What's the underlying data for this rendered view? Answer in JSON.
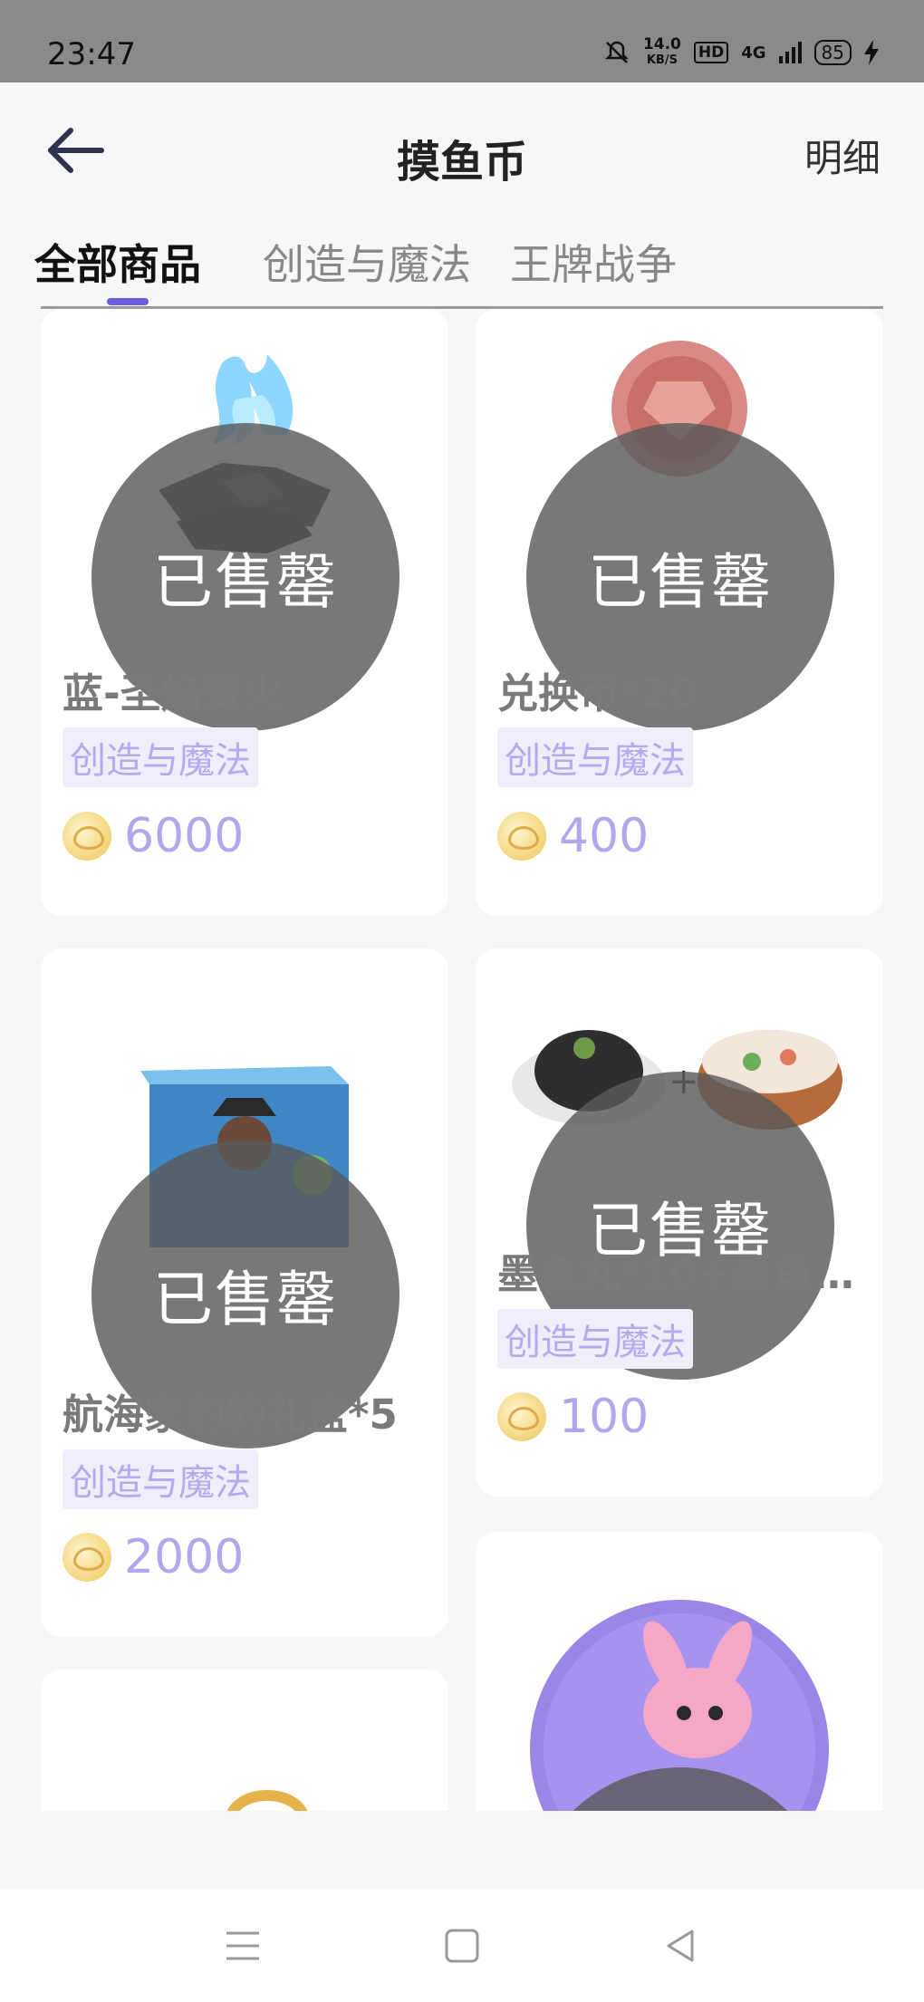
{
  "status_bar": {
    "time": "23:47",
    "speed_value": "14.0",
    "speed_unit": "KB/S",
    "hd": "HD",
    "network": "4G",
    "battery": "85"
  },
  "header": {
    "title": "摸鱼币",
    "detail_label": "明细"
  },
  "tabs": [
    {
      "label": "全部商品",
      "active": true
    },
    {
      "label": "创造与魔法",
      "active": false
    },
    {
      "label": "王牌战争",
      "active": false
    }
  ],
  "sold_out_label": "已售罄",
  "products": [
    {
      "name": "蓝-圣焰篝火",
      "tag": "创造与魔法",
      "price": "6000",
      "sold_out": true,
      "image": "blue-bonfire-icon"
    },
    {
      "name": "兑换币*20",
      "tag": "创造与魔法",
      "price": "400",
      "sold_out": true,
      "image": "exchange-coin-icon"
    },
    {
      "name": "航海家豹豹礼盒*5",
      "tag": "创造与魔法",
      "price": "2000",
      "sold_out": true,
      "image": "gift-box-icon"
    },
    {
      "name": "墨鱼丸*10+墨鱼…",
      "tag": "创造与魔法",
      "price": "100",
      "sold_out": true,
      "image": "squid-ball-dish-icon"
    },
    {
      "name": "",
      "tag": "",
      "price": "",
      "sold_out": true,
      "image": "ring-icon"
    },
    {
      "name": "",
      "tag": "",
      "price": "",
      "sold_out": true,
      "image": "badge-icon"
    }
  ],
  "colors": {
    "accent": "#6a5de0",
    "tag_text": "#b6a9ee",
    "price_text": "#b4a6ec",
    "overlay": "#5a5a5a"
  }
}
